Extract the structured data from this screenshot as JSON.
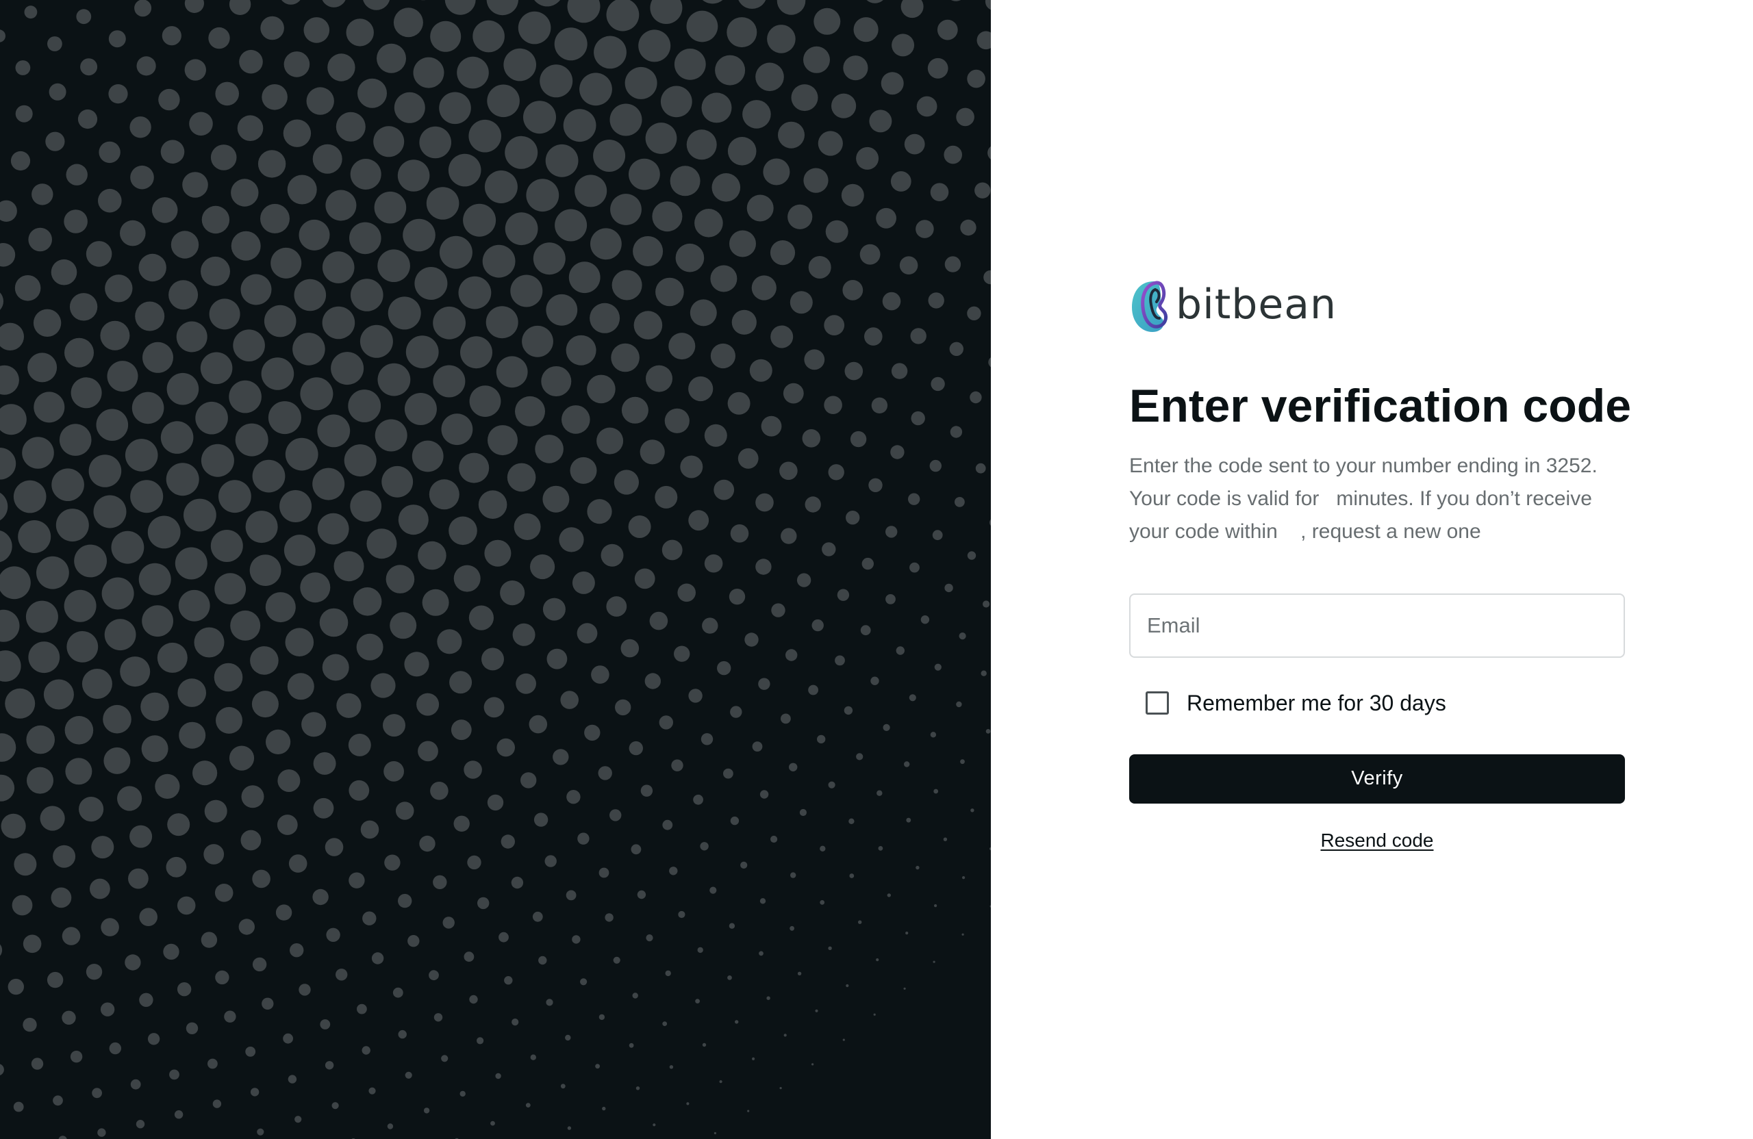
{
  "brand": {
    "name": "bitbean",
    "logo_icon": "bitbean-logo-icon"
  },
  "verification": {
    "title": "Enter verification code",
    "subtitle": "Enter the code sent to your number ending in 3252. Your code is valid for   minutes. If you don’t receive your code within    , request a new one",
    "email_placeholder": "Email",
    "email_value": "",
    "remember_label": "Remember me for 30 days",
    "remember_checked": false,
    "verify_label": "Verify",
    "resend_label": "Resend code"
  },
  "colors": {
    "panel_bg": "#0b1215",
    "dot": "#3e4447",
    "button_bg": "#0b1215",
    "logo_teal": "#4ec3c9",
    "logo_purple": "#7b3fa8"
  }
}
